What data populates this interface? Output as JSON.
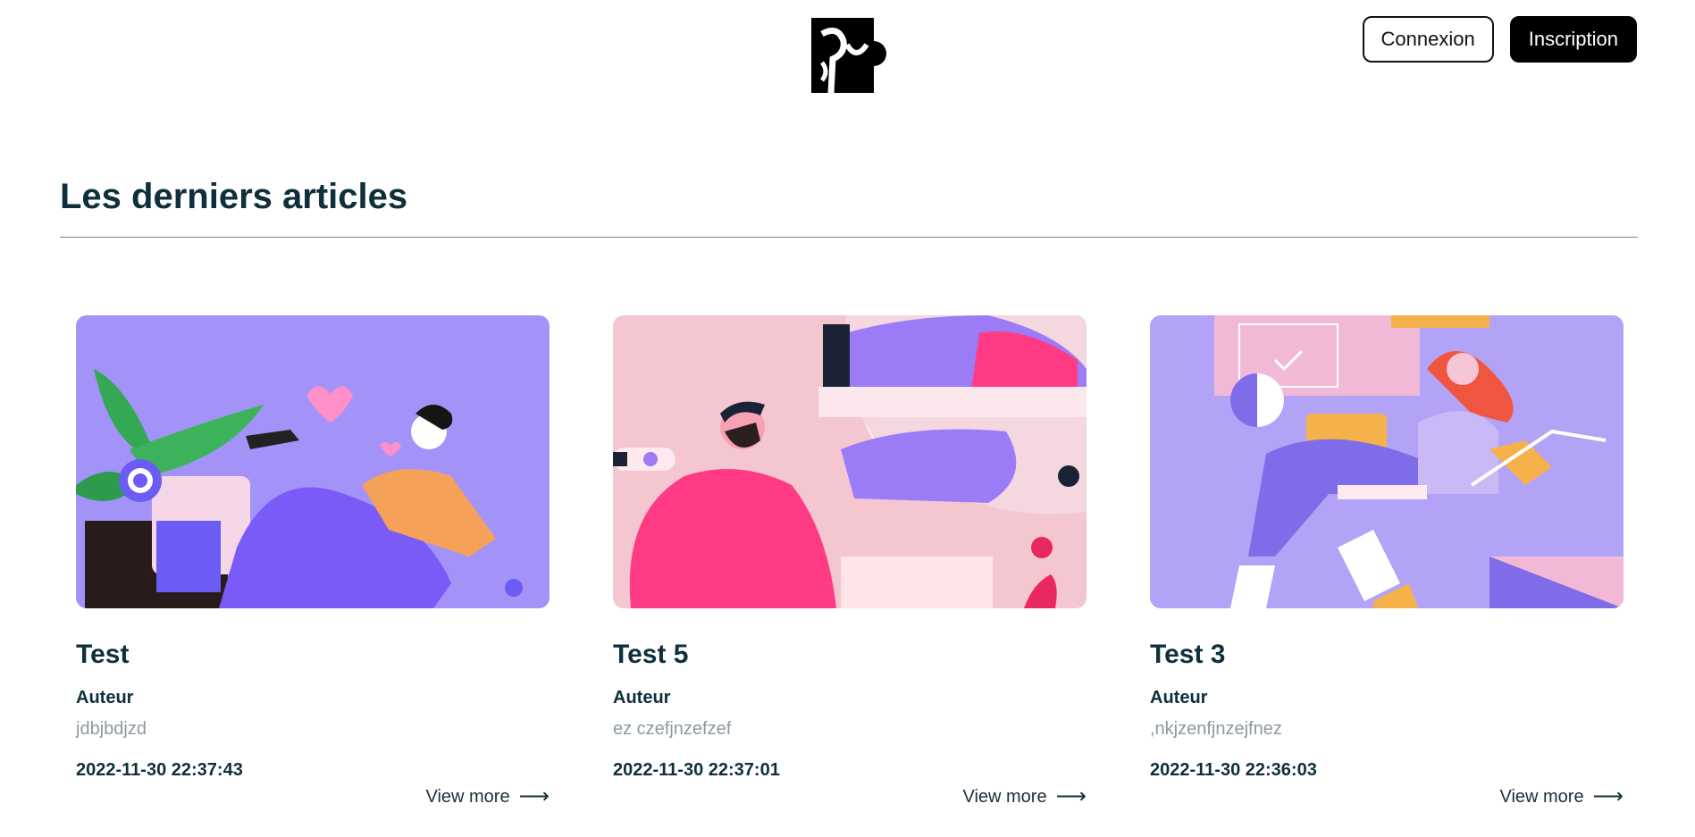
{
  "header": {
    "login_label": "Connexion",
    "signup_label": "Inscription"
  },
  "section": {
    "title": "Les derniers articles"
  },
  "articles": [
    {
      "title": "Test",
      "author_label": "Auteur",
      "author": "jdbjbdjzd",
      "date": "2022-11-30 22:37:43",
      "more_label": "View more",
      "image": "illustration-person-lounging-with-heart"
    },
    {
      "title": "Test 5",
      "author_label": "Auteur",
      "author": "ez czefjnzefzef",
      "date": "2022-11-30 22:37:01",
      "more_label": "View more",
      "image": "illustration-bearded-man-with-mirror"
    },
    {
      "title": "Test 3",
      "author_label": "Auteur",
      "author": ",nkjzenfjnzejfnez",
      "date": "2022-11-30 22:36:03",
      "more_label": "View more",
      "image": "illustration-woman-with-laptop"
    }
  ],
  "colors": {
    "card1_bg": "#a393f9",
    "card2_bg": "#f3c6d0",
    "card3_bg": "#b3a3f7",
    "heading": "#0f2f3d"
  }
}
